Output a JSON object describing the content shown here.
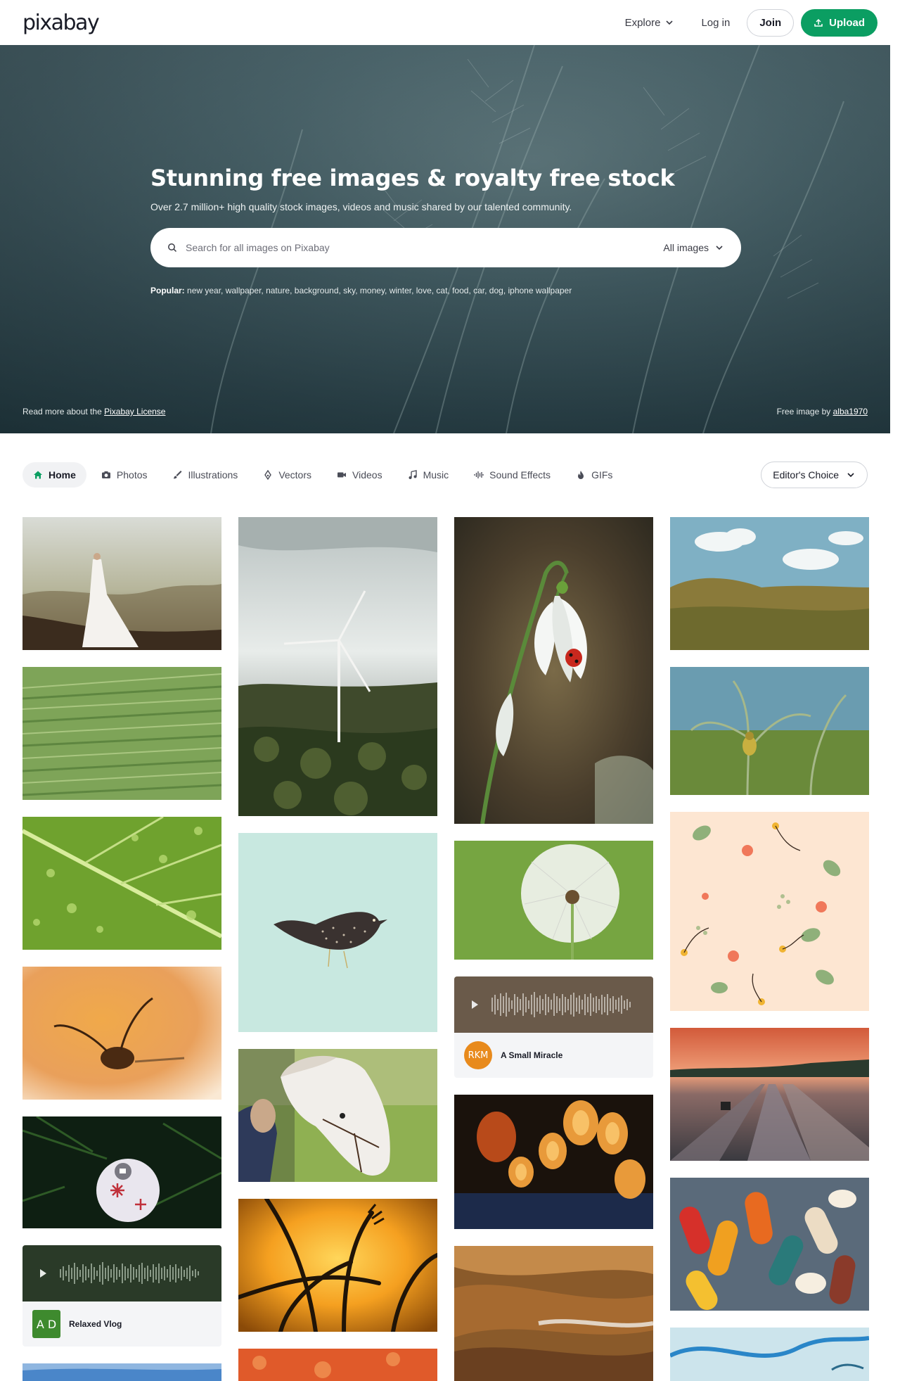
{
  "header": {
    "logo": "pixabay",
    "explore": "Explore",
    "login": "Log in",
    "join": "Join",
    "upload": "Upload"
  },
  "hero": {
    "title": "Stunning free images & royalty free stock",
    "subtitle": "Over 2.7 million+ high quality stock images, videos and music shared by our talented community.",
    "search_placeholder": "Search for all images on Pixabay",
    "search_type": "All images",
    "popular_label": "Popular:",
    "popular_terms": "new year, wallpaper, nature, background, sky, money, winter, love, cat, food, car, dog, iphone wallpaper",
    "license_prefix": "Read more about the",
    "license_link": "Pixabay License",
    "credit_prefix": "Free image by",
    "credit_user": "alba1970"
  },
  "tabs": {
    "items": [
      "Home",
      "Photos",
      "Illustrations",
      "Vectors",
      "Videos",
      "Music",
      "Sound Effects",
      "GIFs"
    ],
    "sort": "Editor's Choice"
  },
  "audio": [
    {
      "title": "A Small Miracle",
      "thumb": "RKM",
      "thumb_color": "#e88a1c"
    },
    {
      "title": "Relaxed Vlog",
      "thumb": "A D",
      "thumb_color": "#3e8a2e"
    }
  ],
  "colors": {
    "accent": "#0b9e62"
  }
}
